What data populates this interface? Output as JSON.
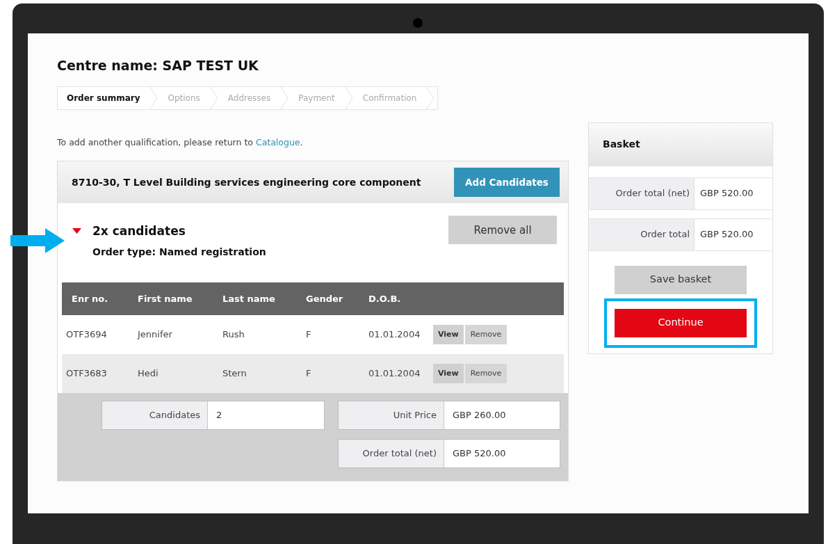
{
  "centre_title": "Centre name: SAP TEST UK",
  "steps": [
    {
      "label": "Order summary",
      "selected": true
    },
    {
      "label": "Options",
      "selected": false
    },
    {
      "label": "Addresses",
      "selected": false
    },
    {
      "label": "Payment",
      "selected": false
    },
    {
      "label": "Confirmation",
      "selected": false
    }
  ],
  "intro": {
    "text": "To add another qualification, please return to ",
    "link": "Catalogue",
    "after": "."
  },
  "qualification": {
    "title": "8710-30, T Level Building services engineering core component",
    "add_button": "Add Candidates",
    "group": {
      "title": "2x candidates",
      "expanded": true,
      "order_type": "Order type: Named registration",
      "remove_all": "Remove all"
    },
    "table": {
      "columns": [
        "Enr no.",
        "First name",
        "Last name",
        "Gender",
        "D.O.B."
      ],
      "rows": [
        {
          "cells": [
            "OTF3694",
            "Jennifer",
            "Rush",
            "F",
            "01.01.2004"
          ],
          "view": "View",
          "remove": "Remove"
        },
        {
          "cells": [
            "OTF3683",
            "Hedi",
            "Stern",
            "F",
            "01.01.2004"
          ],
          "view": "View",
          "remove": "Remove"
        }
      ]
    },
    "summary": {
      "candidates": {
        "label": "Candidates",
        "value": "2"
      },
      "unit_price": {
        "label": "Unit Price",
        "value": "GBP 260.00"
      },
      "order_total_net": {
        "label": "Order total (net)",
        "value": "GBP 520.00"
      }
    }
  },
  "basket": {
    "title": "Basket",
    "lines": [
      {
        "label": "Order total (net)",
        "value": "GBP 520.00"
      },
      {
        "label": "Order total",
        "value": "GBP 520.00"
      }
    ],
    "save_button": "Save basket",
    "continue_button": "Continue"
  }
}
